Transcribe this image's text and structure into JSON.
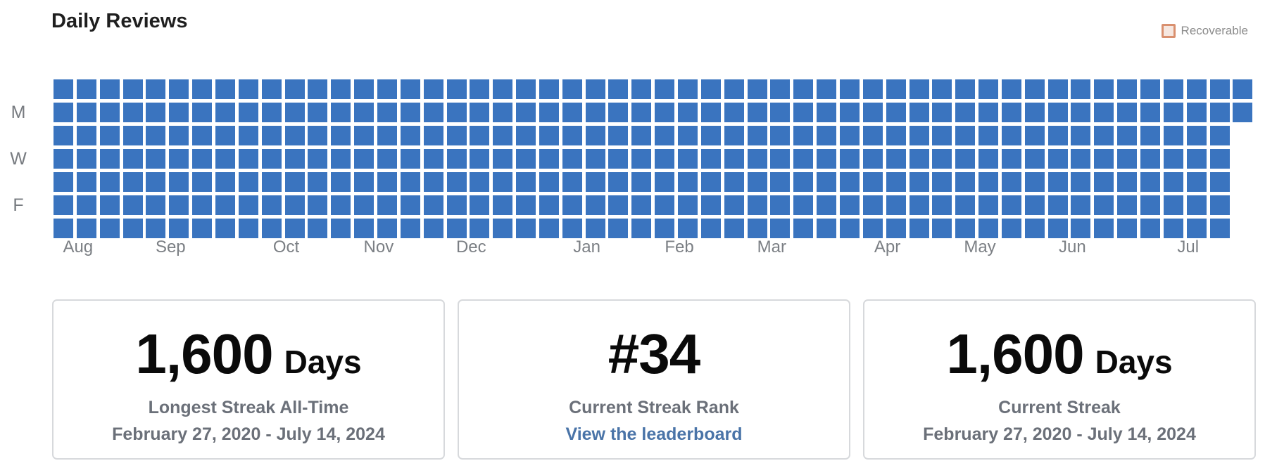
{
  "header": {
    "title": "Daily Reviews"
  },
  "legend": {
    "label": "Recoverable",
    "color": "#d9906f"
  },
  "heatmap": {
    "cell_color": "#3a74bf",
    "day_labels": [
      "",
      "M",
      "",
      "W",
      "",
      "F",
      ""
    ],
    "weeks": 52,
    "partial_last_week_days": 2,
    "months": [
      {
        "label": "Aug",
        "week": 1
      },
      {
        "label": "Sep",
        "week": 5
      },
      {
        "label": "Oct",
        "week": 10
      },
      {
        "label": "Nov",
        "week": 14
      },
      {
        "label": "Dec",
        "week": 18
      },
      {
        "label": "Jan",
        "week": 23
      },
      {
        "label": "Feb",
        "week": 27
      },
      {
        "label": "Mar",
        "week": 31
      },
      {
        "label": "Apr",
        "week": 36
      },
      {
        "label": "May",
        "week": 40
      },
      {
        "label": "Jun",
        "week": 44
      },
      {
        "label": "Jul",
        "week": 49
      }
    ]
  },
  "stats": {
    "longest": {
      "value": "1,600",
      "unit": "Days",
      "label": "Longest Streak All-Time",
      "range": "February 27, 2020 - July 14, 2024"
    },
    "rank": {
      "value": "#34",
      "label": "Current Streak Rank",
      "link": "View the leaderboard"
    },
    "current": {
      "value": "1,600",
      "unit": "Days",
      "label": "Current Streak",
      "range": "February 27, 2020 - July 14, 2024"
    }
  }
}
